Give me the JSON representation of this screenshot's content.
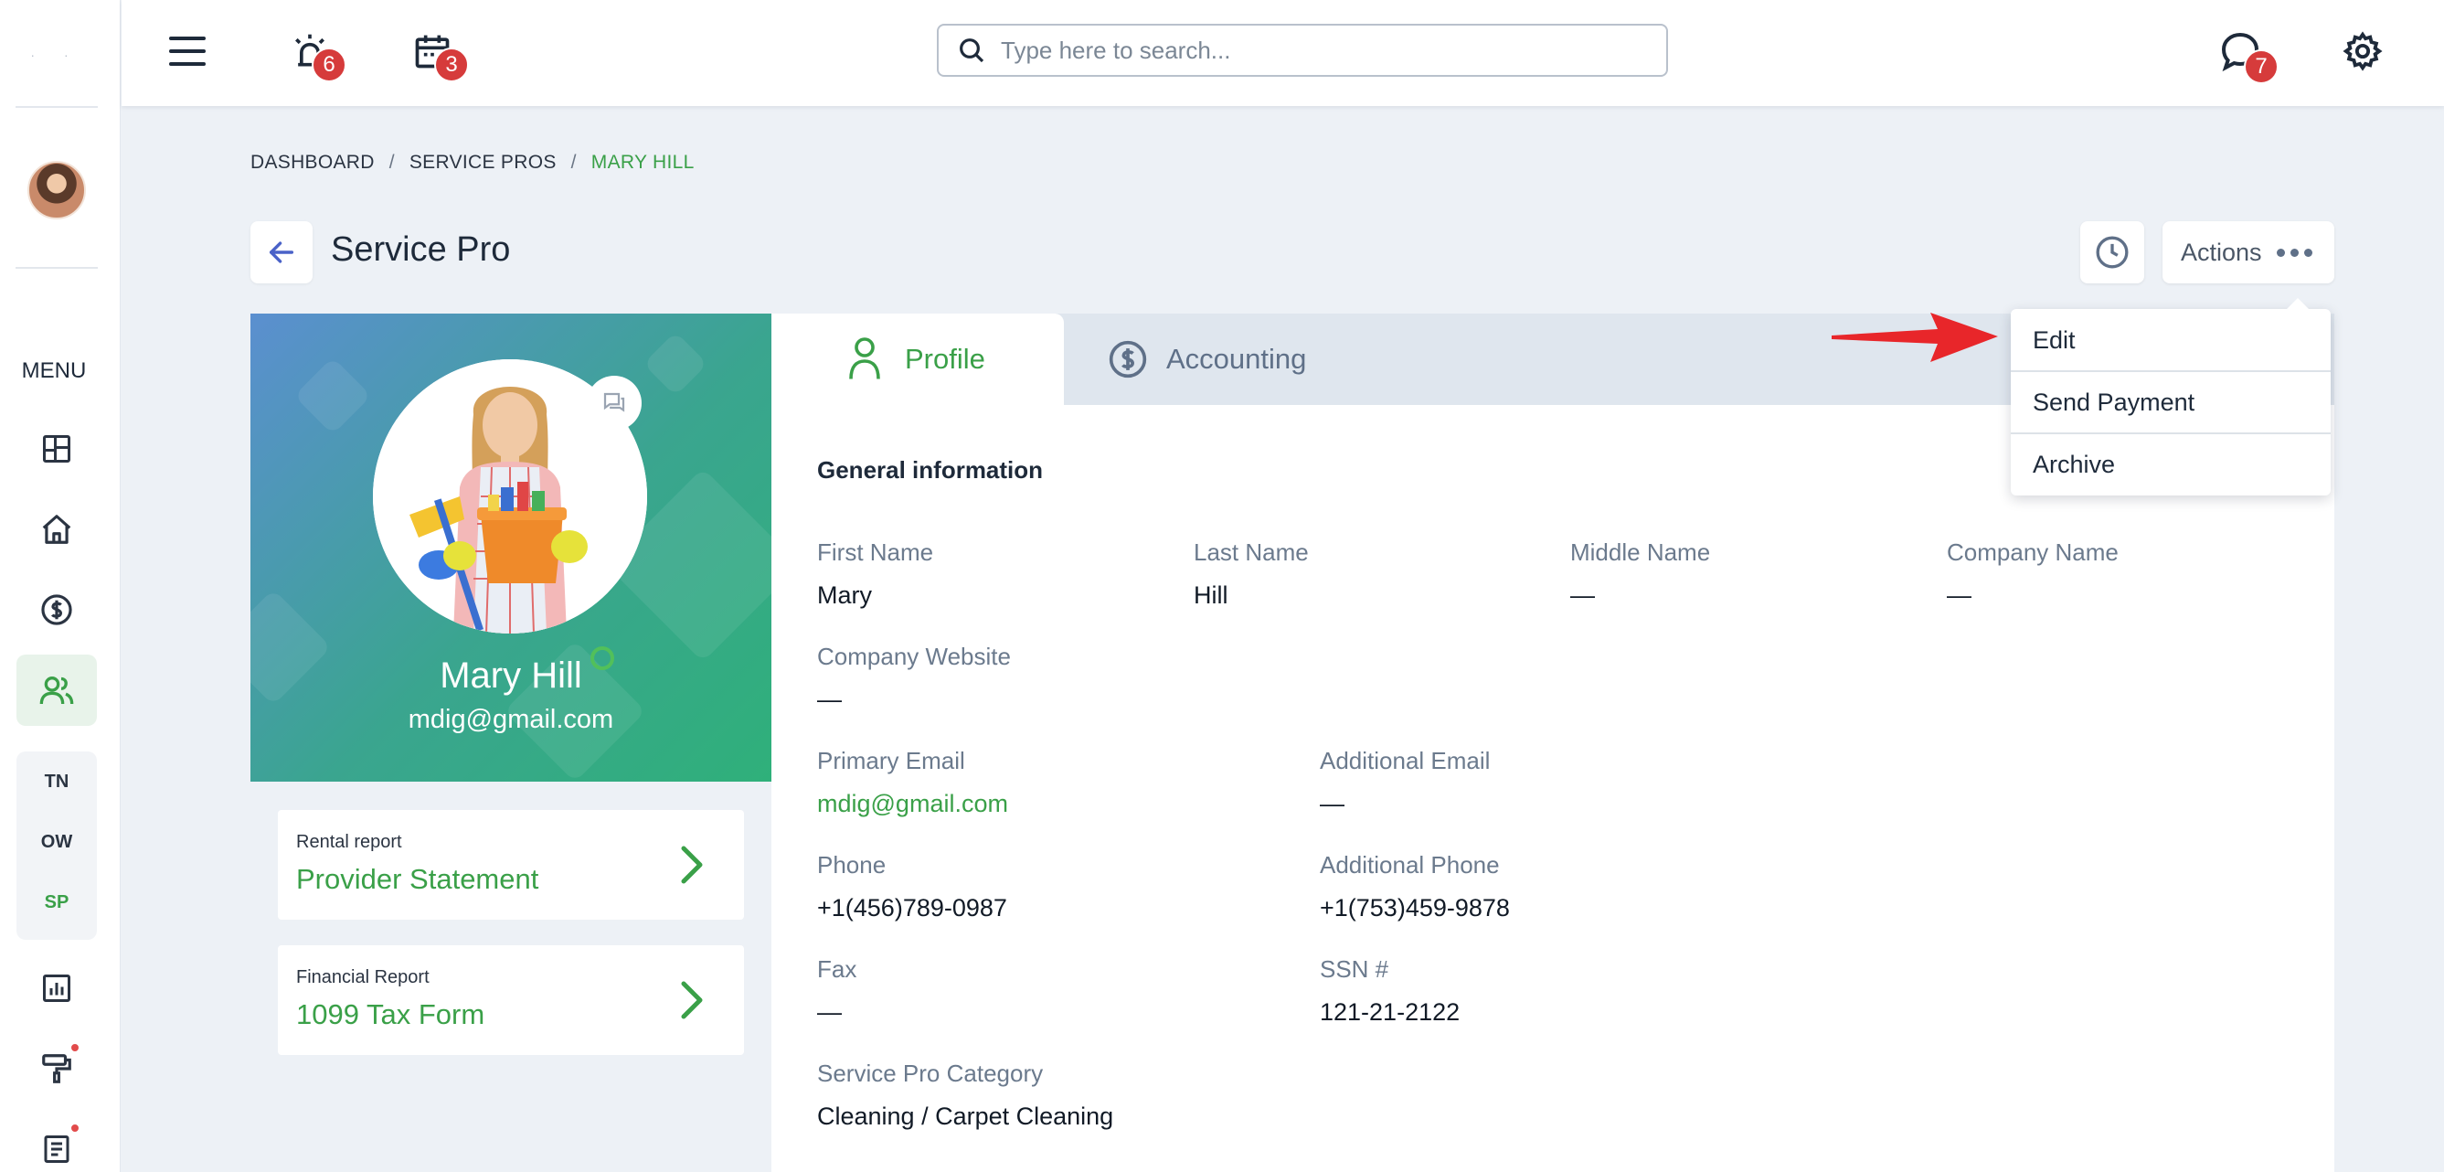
{
  "sidebar": {
    "menu_label": "MENU",
    "group": {
      "items": [
        "TN",
        "OW",
        "SP"
      ]
    },
    "icons": [
      "dashboard-icon",
      "home-icon",
      "dollar-icon",
      "users-icon",
      "chart-icon",
      "paint-roller-icon",
      "document-icon"
    ]
  },
  "topbar": {
    "search_placeholder": "Type here to search...",
    "alarm_badge": "6",
    "calendar_badge": "3",
    "chat_badge": "7"
  },
  "breadcrumb": {
    "items": [
      "DASHBOARD",
      "SERVICE PROS",
      "MARY HILL"
    ],
    "separator": "/"
  },
  "page": {
    "title": "Service Pro",
    "actions_label": "Actions"
  },
  "profile": {
    "name": "Mary Hill",
    "email": "mdig@gmail.com"
  },
  "reports": [
    {
      "label": "Rental report",
      "value": "Provider Statement"
    },
    {
      "label": "Financial Report",
      "value": "1099 Tax Form"
    }
  ],
  "tabs": {
    "profile": "Profile",
    "accounting": "Accounting"
  },
  "general": {
    "title": "General information",
    "first_name": {
      "label": "First Name",
      "value": "Mary"
    },
    "last_name": {
      "label": "Last Name",
      "value": "Hill"
    },
    "middle_name": {
      "label": "Middle Name",
      "value": "—"
    },
    "company_name": {
      "label": "Company Name",
      "value": "—"
    },
    "company_website": {
      "label": "Company Website",
      "value": "—"
    },
    "primary_email": {
      "label": "Primary Email",
      "value": "mdig@gmail.com"
    },
    "additional_email": {
      "label": "Additional Email",
      "value": "—"
    },
    "phone": {
      "label": "Phone",
      "value": "+1(456)789-0987"
    },
    "additional_phone": {
      "label": "Additional Phone",
      "value": "+1(753)459-9878"
    },
    "fax": {
      "label": "Fax",
      "value": "—"
    },
    "ssn": {
      "label": "SSN #",
      "value": "121-21-2122"
    },
    "category": {
      "label": "Service Pro Category",
      "value": "Cleaning / Carpet Cleaning"
    }
  },
  "dropdown": {
    "items": [
      "Edit",
      "Send Payment",
      "Archive"
    ]
  },
  "colors": {
    "accent_green": "#3aa048",
    "badge_red": "#d63b3b",
    "annotation_red": "#e8262a"
  }
}
